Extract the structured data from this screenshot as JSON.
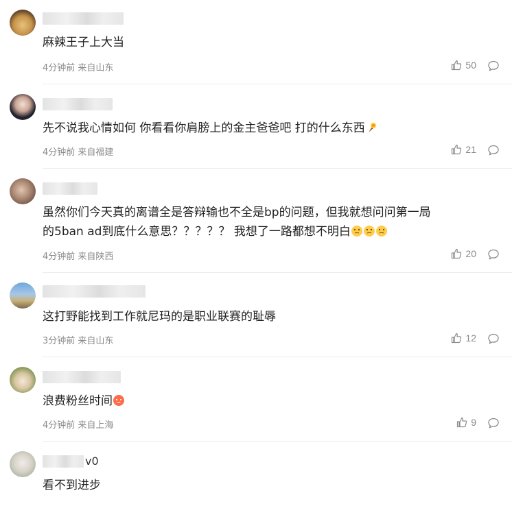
{
  "comments": [
    {
      "username_suffix": "",
      "text": "麻辣王子上大当",
      "time": "4分钟前",
      "location": "来自山东",
      "likes": "50"
    },
    {
      "username_suffix": "",
      "text": "先不说我心情如何 你看看你肩膀上的金主爸爸吧 打的什么东西",
      "time": "4分钟前",
      "location": "来自福建",
      "likes": "21"
    },
    {
      "username_suffix": "",
      "text_line1": "虽然你们今天真的离谱全是答辩输也不全是bp的问题，但我就想问问第一局",
      "text_line2": "的5ban ad到底什么意思？？？？？ 我想了一路都想不明白",
      "time": "4分钟前",
      "location": "来自陕西",
      "likes": "20"
    },
    {
      "username_suffix": "",
      "text": "这打野能找到工作就尼玛的是职业联赛的耻辱",
      "time": "3分钟前",
      "location": "来自山东",
      "likes": "12"
    },
    {
      "username_suffix": "",
      "text": "浪费粉丝时间",
      "time": "4分钟前",
      "location": "来自上海",
      "likes": "9"
    },
    {
      "username_suffix": "v0",
      "text": "看不到进步"
    }
  ]
}
